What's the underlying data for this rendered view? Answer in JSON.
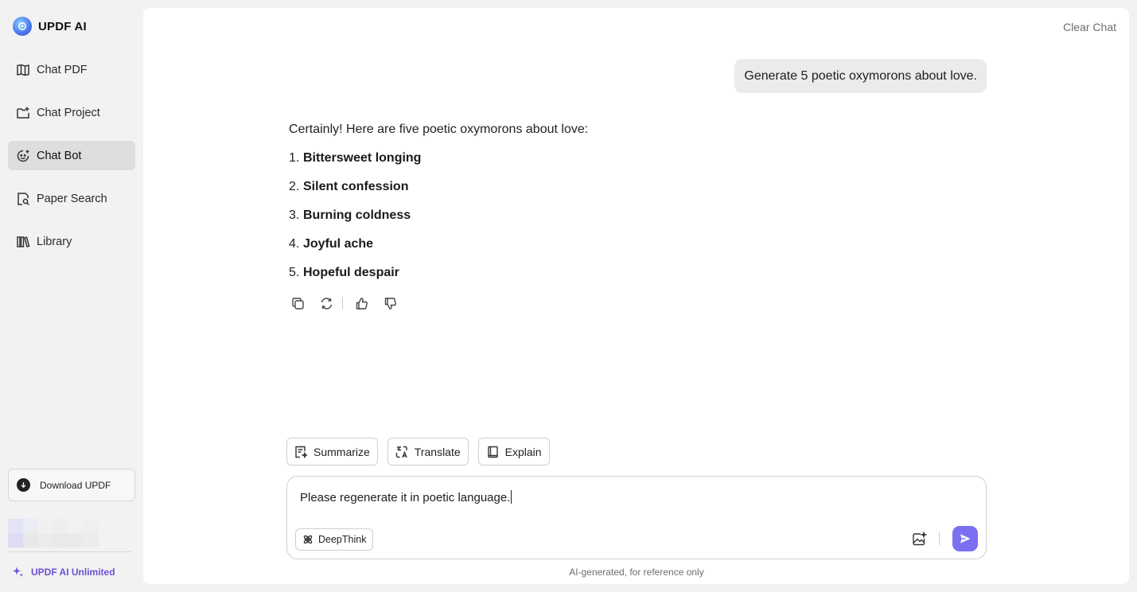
{
  "brand": {
    "name": "UPDF AI"
  },
  "sidebar": {
    "items": [
      {
        "label": "Chat PDF",
        "icon": "book-open-icon",
        "active": false
      },
      {
        "label": "Chat Project",
        "icon": "folder-plus-icon",
        "active": false
      },
      {
        "label": "Chat Bot",
        "icon": "bot-chat-icon",
        "active": true
      },
      {
        "label": "Paper Search",
        "icon": "document-search-icon",
        "active": false
      },
      {
        "label": "Library",
        "icon": "library-icon",
        "active": false
      }
    ],
    "download_label": "Download UPDF",
    "unlimited_label": "UPDF AI Unlimited"
  },
  "header": {
    "clear_chat": "Clear Chat"
  },
  "chat": {
    "user_message": "Generate 5 poetic oxymorons about love.",
    "reply_intro": "Certainly! Here are five poetic oxymorons about love:",
    "reply_items": [
      {
        "num": "1.",
        "term": "Bittersweet longing"
      },
      {
        "num": "2.",
        "term": "Silent confession"
      },
      {
        "num": "3.",
        "term": "Burning coldness"
      },
      {
        "num": "4.",
        "term": "Joyful ache"
      },
      {
        "num": "5.",
        "term": "Hopeful despair"
      }
    ]
  },
  "quick_actions": [
    {
      "label": "Summarize",
      "icon": "summarize-icon"
    },
    {
      "label": "Translate",
      "icon": "translate-icon"
    },
    {
      "label": "Explain",
      "icon": "explain-book-icon"
    }
  ],
  "composer": {
    "value": "Please regenerate it in poetic language.",
    "deepthink_label": "DeepThink"
  },
  "footer": {
    "disclaimer": "AI-generated, for reference only"
  },
  "colors": {
    "accent": "#7b6ff2",
    "unlimited": "#6b4fd8",
    "active_nav_bg": "#dedede",
    "app_bg": "#f2f2f2",
    "panel_bg": "#ffffff"
  }
}
